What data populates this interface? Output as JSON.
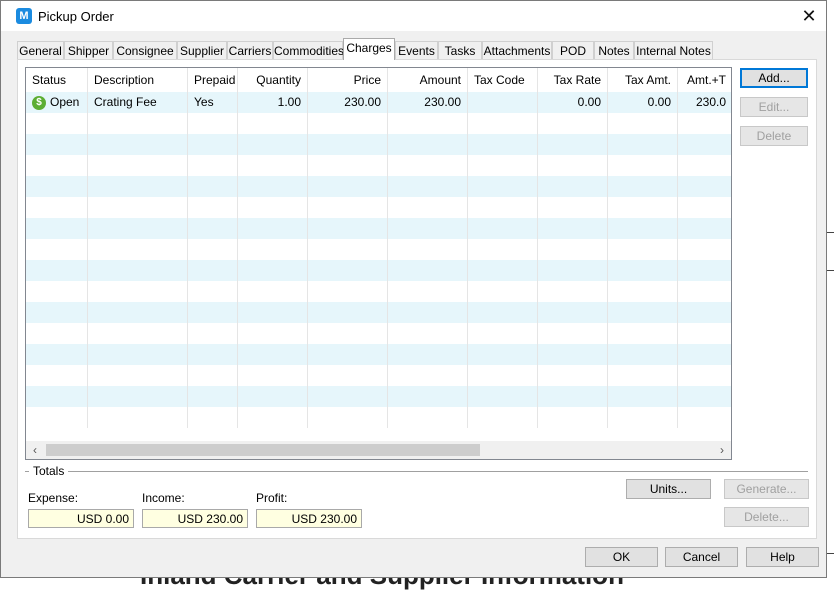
{
  "window": {
    "title": "Pickup Order",
    "icon": "app-logo-icon"
  },
  "tabs": [
    "General",
    "Shipper",
    "Consignee",
    "Supplier",
    "Carriers",
    "Commodities",
    "Charges",
    "Events",
    "Tasks",
    "Attachments",
    "POD",
    "Notes",
    "Internal Notes"
  ],
  "active_tab": "Charges",
  "grid": {
    "columns": [
      "Status",
      "Description",
      "Prepaid",
      "Quantity",
      "Price",
      "Amount",
      "Tax Code",
      "Tax Rate",
      "Tax Amt.",
      "Amt.+T"
    ],
    "rows": [
      {
        "status_icon": "dollar-icon",
        "status": "Open",
        "description": "Crating Fee",
        "prepaid": "Yes",
        "quantity": "1.00",
        "price": "230.00",
        "amount": "230.00",
        "tax_code": "",
        "tax_rate": "0.00",
        "tax_amt": "0.00",
        "amt_t": "230.0"
      }
    ]
  },
  "side_buttons": {
    "add": "Add...",
    "edit": "Edit...",
    "delete": "Delete"
  },
  "totals": {
    "label": "Totals",
    "expense_label": "Expense:",
    "expense": "USD 0.00",
    "income_label": "Income:",
    "income": "USD 230.00",
    "profit_label": "Profit:",
    "profit": "USD 230.00"
  },
  "bottom_buttons": {
    "units": "Units...",
    "generate": "Generate...",
    "delete": "Delete..."
  },
  "dialog_buttons": {
    "ok": "OK",
    "cancel": "Cancel",
    "help": "Help"
  },
  "background": {
    "text": "Inland Carrier and Supplier Information"
  }
}
